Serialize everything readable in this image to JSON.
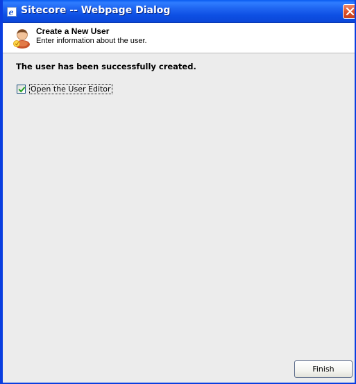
{
  "window": {
    "title": "Sitecore -- Webpage Dialog",
    "title_icon": "ie-page-icon",
    "close_icon": "close-icon"
  },
  "header": {
    "icon": "user-icon",
    "title": "Create a New User",
    "subtitle": "Enter information about the user."
  },
  "content": {
    "message": "The user has been successfully created.",
    "checkbox": {
      "label": "Open the User Editor",
      "checked": true
    }
  },
  "footer": {
    "finish_label": "Finish"
  },
  "colors": {
    "titlebar": "#0b47d8",
    "window_border": "#0a3ee0",
    "body_bg": "#ececec",
    "close_button": "#e0542a",
    "checkmark": "#21a121"
  }
}
